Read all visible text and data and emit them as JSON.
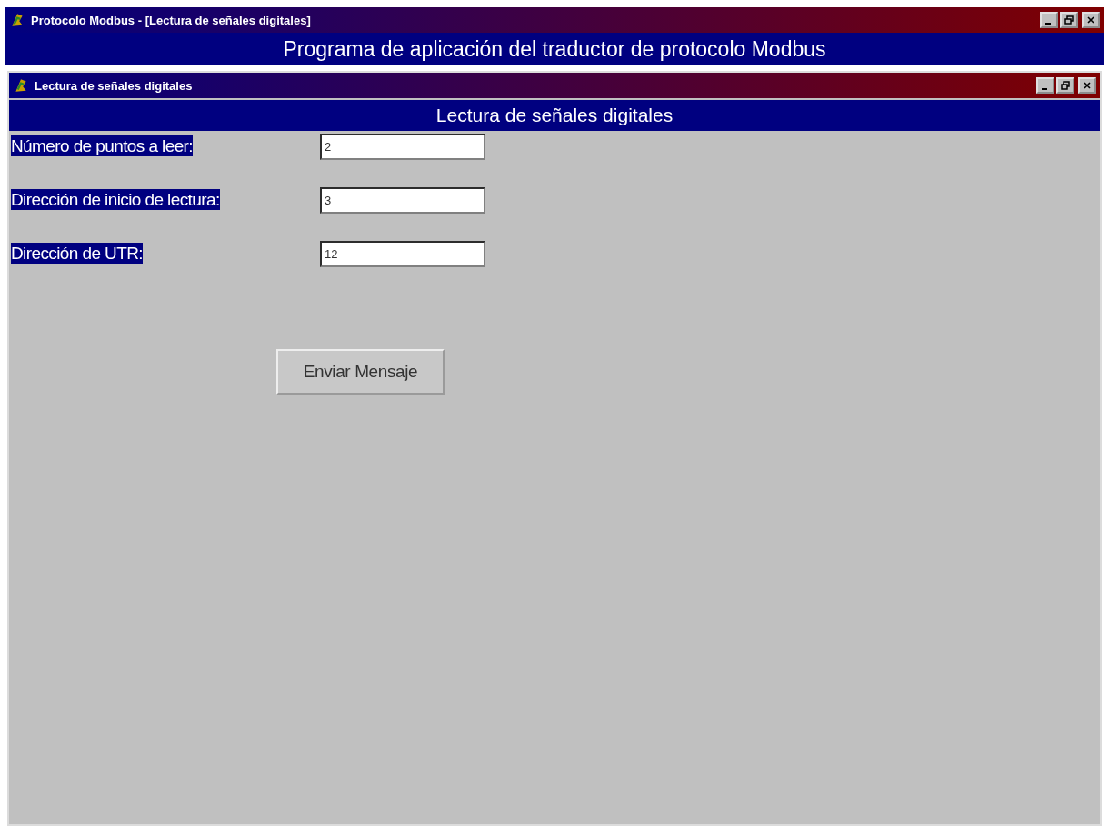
{
  "window": {
    "title": "Protocolo Modbus - [Lectura de señales digitales]"
  },
  "banner": "Programa de aplicación del traductor de protocolo Modbus",
  "child_window": {
    "title": "Lectura de señales digitales",
    "heading": "Lectura de señales digitales",
    "fields": [
      {
        "label": "Número de puntos a leer:",
        "value": "2"
      },
      {
        "label": "Dirección de inicio de lectura:",
        "value": "3"
      },
      {
        "label": "Dirección de UTR:",
        "value": "12"
      }
    ],
    "button": "Enviar Mensaje"
  }
}
